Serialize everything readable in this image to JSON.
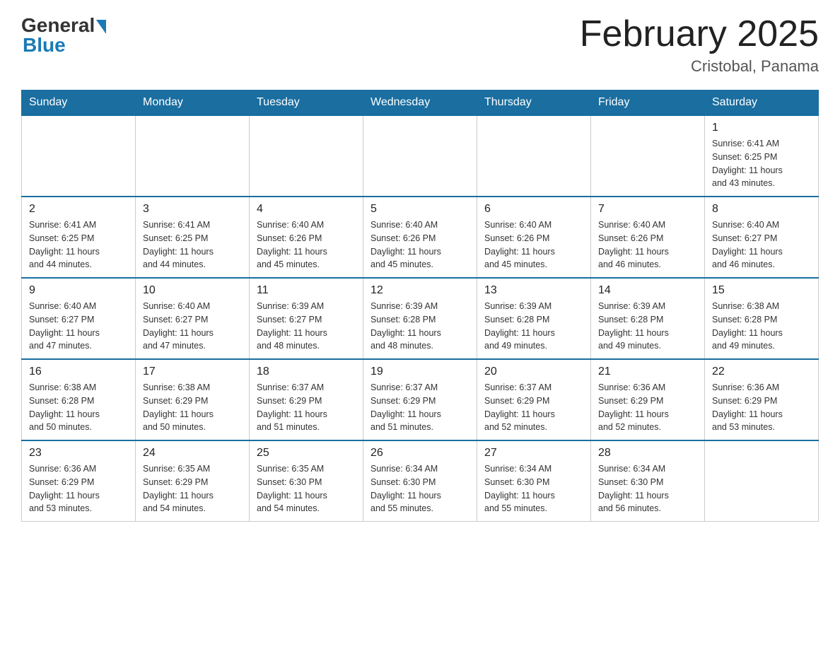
{
  "logo": {
    "general": "General",
    "blue": "Blue"
  },
  "title": "February 2025",
  "location": "Cristobal, Panama",
  "days_of_week": [
    "Sunday",
    "Monday",
    "Tuesday",
    "Wednesday",
    "Thursday",
    "Friday",
    "Saturday"
  ],
  "weeks": [
    [
      {
        "day": "",
        "info": ""
      },
      {
        "day": "",
        "info": ""
      },
      {
        "day": "",
        "info": ""
      },
      {
        "day": "",
        "info": ""
      },
      {
        "day": "",
        "info": ""
      },
      {
        "day": "",
        "info": ""
      },
      {
        "day": "1",
        "info": "Sunrise: 6:41 AM\nSunset: 6:25 PM\nDaylight: 11 hours\nand 43 minutes."
      }
    ],
    [
      {
        "day": "2",
        "info": "Sunrise: 6:41 AM\nSunset: 6:25 PM\nDaylight: 11 hours\nand 44 minutes."
      },
      {
        "day": "3",
        "info": "Sunrise: 6:41 AM\nSunset: 6:25 PM\nDaylight: 11 hours\nand 44 minutes."
      },
      {
        "day": "4",
        "info": "Sunrise: 6:40 AM\nSunset: 6:26 PM\nDaylight: 11 hours\nand 45 minutes."
      },
      {
        "day": "5",
        "info": "Sunrise: 6:40 AM\nSunset: 6:26 PM\nDaylight: 11 hours\nand 45 minutes."
      },
      {
        "day": "6",
        "info": "Sunrise: 6:40 AM\nSunset: 6:26 PM\nDaylight: 11 hours\nand 45 minutes."
      },
      {
        "day": "7",
        "info": "Sunrise: 6:40 AM\nSunset: 6:26 PM\nDaylight: 11 hours\nand 46 minutes."
      },
      {
        "day": "8",
        "info": "Sunrise: 6:40 AM\nSunset: 6:27 PM\nDaylight: 11 hours\nand 46 minutes."
      }
    ],
    [
      {
        "day": "9",
        "info": "Sunrise: 6:40 AM\nSunset: 6:27 PM\nDaylight: 11 hours\nand 47 minutes."
      },
      {
        "day": "10",
        "info": "Sunrise: 6:40 AM\nSunset: 6:27 PM\nDaylight: 11 hours\nand 47 minutes."
      },
      {
        "day": "11",
        "info": "Sunrise: 6:39 AM\nSunset: 6:27 PM\nDaylight: 11 hours\nand 48 minutes."
      },
      {
        "day": "12",
        "info": "Sunrise: 6:39 AM\nSunset: 6:28 PM\nDaylight: 11 hours\nand 48 minutes."
      },
      {
        "day": "13",
        "info": "Sunrise: 6:39 AM\nSunset: 6:28 PM\nDaylight: 11 hours\nand 49 minutes."
      },
      {
        "day": "14",
        "info": "Sunrise: 6:39 AM\nSunset: 6:28 PM\nDaylight: 11 hours\nand 49 minutes."
      },
      {
        "day": "15",
        "info": "Sunrise: 6:38 AM\nSunset: 6:28 PM\nDaylight: 11 hours\nand 49 minutes."
      }
    ],
    [
      {
        "day": "16",
        "info": "Sunrise: 6:38 AM\nSunset: 6:28 PM\nDaylight: 11 hours\nand 50 minutes."
      },
      {
        "day": "17",
        "info": "Sunrise: 6:38 AM\nSunset: 6:29 PM\nDaylight: 11 hours\nand 50 minutes."
      },
      {
        "day": "18",
        "info": "Sunrise: 6:37 AM\nSunset: 6:29 PM\nDaylight: 11 hours\nand 51 minutes."
      },
      {
        "day": "19",
        "info": "Sunrise: 6:37 AM\nSunset: 6:29 PM\nDaylight: 11 hours\nand 51 minutes."
      },
      {
        "day": "20",
        "info": "Sunrise: 6:37 AM\nSunset: 6:29 PM\nDaylight: 11 hours\nand 52 minutes."
      },
      {
        "day": "21",
        "info": "Sunrise: 6:36 AM\nSunset: 6:29 PM\nDaylight: 11 hours\nand 52 minutes."
      },
      {
        "day": "22",
        "info": "Sunrise: 6:36 AM\nSunset: 6:29 PM\nDaylight: 11 hours\nand 53 minutes."
      }
    ],
    [
      {
        "day": "23",
        "info": "Sunrise: 6:36 AM\nSunset: 6:29 PM\nDaylight: 11 hours\nand 53 minutes."
      },
      {
        "day": "24",
        "info": "Sunrise: 6:35 AM\nSunset: 6:29 PM\nDaylight: 11 hours\nand 54 minutes."
      },
      {
        "day": "25",
        "info": "Sunrise: 6:35 AM\nSunset: 6:30 PM\nDaylight: 11 hours\nand 54 minutes."
      },
      {
        "day": "26",
        "info": "Sunrise: 6:34 AM\nSunset: 6:30 PM\nDaylight: 11 hours\nand 55 minutes."
      },
      {
        "day": "27",
        "info": "Sunrise: 6:34 AM\nSunset: 6:30 PM\nDaylight: 11 hours\nand 55 minutes."
      },
      {
        "day": "28",
        "info": "Sunrise: 6:34 AM\nSunset: 6:30 PM\nDaylight: 11 hours\nand 56 minutes."
      },
      {
        "day": "",
        "info": ""
      }
    ]
  ]
}
